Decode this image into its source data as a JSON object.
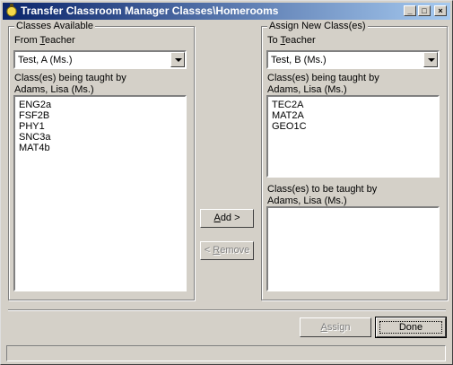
{
  "window": {
    "title": "Transfer Classroom Manager Classes\\Homerooms"
  },
  "title_buttons": {
    "minimize": "_",
    "maximize": "□",
    "close": "×"
  },
  "left_panel": {
    "group_title": "Classes Available",
    "from_label_pre": "From ",
    "from_label_ul": "T",
    "from_label_post": "eacher",
    "teacher_value": "Test, A (Ms.)",
    "taught_by_line1": "Class(es) being taught by",
    "taught_by_line2": "Adams, Lisa (Ms.)",
    "classes": [
      "ENG2a",
      "FSF2B",
      "PHY1",
      "SNC3a",
      "MAT4b"
    ]
  },
  "right_panel": {
    "group_title": "Assign New Class(es)",
    "to_label_pre": "To ",
    "to_label_ul": "T",
    "to_label_post": "eacher",
    "teacher_value": "Test, B (Ms.)",
    "taught_by_line1": "Class(es) being taught by",
    "taught_by_line2": "Adams, Lisa (Ms.)",
    "classes": [
      "TEC2A",
      "MAT2A",
      "GEO1C"
    ],
    "to_be_taught_line1": "Class(es) to be taught by",
    "to_be_taught_line2": "Adams, Lisa (Ms.)",
    "to_be_taught_classes": []
  },
  "buttons": {
    "add_ul": "A",
    "add_rest": "dd >",
    "remove_pre": "< ",
    "remove_ul": "R",
    "remove_rest": "emove",
    "assign_ul": "A",
    "assign_rest": "ssign",
    "done": "Done"
  }
}
